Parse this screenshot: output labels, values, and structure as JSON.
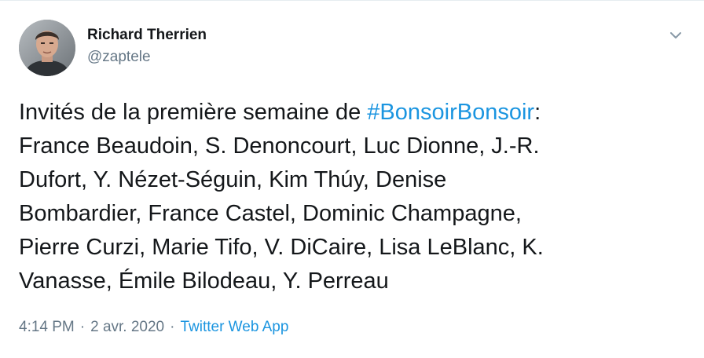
{
  "author": {
    "display_name": "Richard Therrien",
    "handle": "@zaptele",
    "avatar_icon": "person-portrait-avatar"
  },
  "menu": {
    "icon": "chevron-down-icon"
  },
  "tweet": {
    "lines": {
      "l1_before": "Invités de la première semaine de ",
      "l1_hashtag": "#BonsoirBonsoir",
      "l1_after": ":",
      "l2": "France Beaudoin, S. Denoncourt, Luc Dionne, J.-R.",
      "l3": "Dufort, Y. Nézet-Séguin, Kim Thúy, Denise",
      "l4": "Bombardier, France Castel, Dominic Champagne,",
      "l5": "Pierre Curzi, Marie Tifo, V. DiCaire, Lisa LeBlanc, K.",
      "l6": "Vanasse, Émile Bilodeau, Y. Perreau"
    }
  },
  "meta": {
    "time": "4:14 PM",
    "separator": "·",
    "date": "2 avr. 2020",
    "source": "Twitter Web App"
  },
  "colors": {
    "link": "#1b95e0",
    "secondary_text": "#657786",
    "primary_text": "#14171a"
  }
}
